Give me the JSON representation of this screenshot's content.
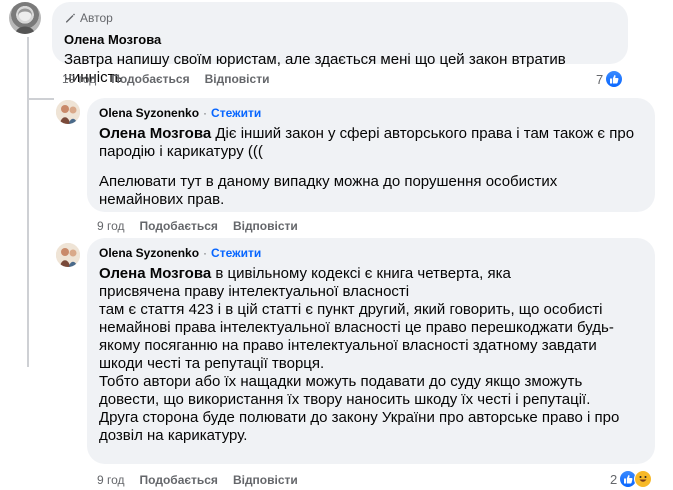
{
  "comment1": {
    "badge": "Автор",
    "author": "Олена Мозгова",
    "text": "Завтра напишу своїм юристам, але здається мені що цей закон втратив чинність",
    "time": "19 год",
    "like_label": "Подобається",
    "reply_label": "Відповісти",
    "reaction_count": "7"
  },
  "reply1": {
    "author": "Olena Syzonenko",
    "dot": "·",
    "follow_label": "Стежити",
    "mention": "Олена Мозгова",
    "text_p1": " Діє інший закон у сфері авторського права і там також є про пародію і карикатуру (((",
    "text_p2": "Апелювати тут в даному випадку можна до порушення особистих немайнових прав.",
    "time": "9 год",
    "like_label": "Подобається",
    "reply_label": "Відповісти"
  },
  "reply2": {
    "author": "Olena Syzonenko",
    "dot": "·",
    "follow_label": "Стежити",
    "mention": "Олена Мозгова",
    "text_p1": " в цивільному кодексі є книга четверта, яка присвячена праву інтелектуальної власності",
    "text_p2": "там є стаття 423 і в цій статті є пункт другий, який говорить, що особисті немайнові права інтелектуальної власності це право перешкоджати будь-якому посяганню на право інтелектуальної власності здатному завдати шкоди честі та репутації творця.",
    "text_p3": "Тобто автори або їх нащадки можуть подавати до суду якщо зможуть довести, що використання їх твору наносить шкоду їх честі і репутації.",
    "text_p4": "Друга сторона буде полювати до закону України про авторське право і про дозвіл на карикатуру.",
    "time": "9 год",
    "like_label": "Подобається",
    "reply_label": "Відповісти",
    "reaction_count": "2"
  },
  "colors": {
    "bubble": "#f0f2f5",
    "link_blue": "#0866ff",
    "meta_gray": "#65676b"
  },
  "icons": [
    "pen-icon",
    "like-icon",
    "haha-icon",
    "avatar"
  ]
}
